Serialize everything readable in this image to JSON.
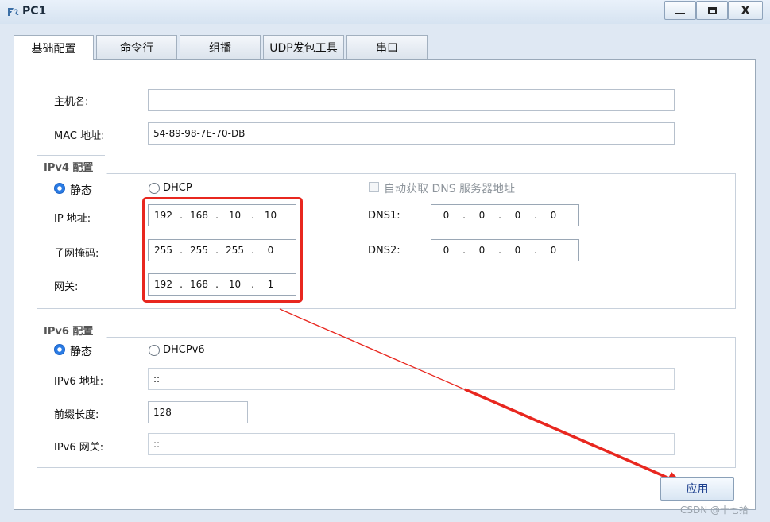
{
  "window": {
    "title": "PC1",
    "close_symbol": "X"
  },
  "tabs": [
    {
      "label": "基础配置",
      "active": true
    },
    {
      "label": "命令行"
    },
    {
      "label": "组播"
    },
    {
      "label": "UDP发包工具"
    },
    {
      "label": "串口"
    }
  ],
  "basic": {
    "hostname_label": "主机名:",
    "hostname_value": "",
    "mac_label": "MAC 地址:",
    "mac_value": "54-89-98-7E-70-DB"
  },
  "ipv4": {
    "section_title": "IPv4 配置",
    "static_label": "静态",
    "dhcp_label": "DHCP",
    "auto_dns_label": "自动获取 DNS 服务器地址",
    "ip_label": "IP 地址:",
    "ip": [
      "192",
      "168",
      "10",
      "10"
    ],
    "mask_label": "子网掩码:",
    "mask": [
      "255",
      "255",
      "255",
      "0"
    ],
    "gateway_label": "网关:",
    "gateway": [
      "192",
      "168",
      "10",
      "1"
    ],
    "dns1_label": "DNS1:",
    "dns1": [
      "0",
      "0",
      "0",
      "0"
    ],
    "dns2_label": "DNS2:",
    "dns2": [
      "0",
      "0",
      "0",
      "0"
    ]
  },
  "ipv6": {
    "section_title": "IPv6 配置",
    "static_label": "静态",
    "dhcp_label": "DHCPv6",
    "ip_label": "IPv6 地址:",
    "ip_value": "::",
    "prefix_label": "前缀长度:",
    "prefix_value": "128",
    "gateway_label": "IPv6 网关:",
    "gateway_value": "::"
  },
  "apply_label": "应用",
  "watermark": "CSDN @十七拾",
  "colors": {
    "annotation_red": "#e8271f",
    "radio_blue": "#2a7be4"
  }
}
